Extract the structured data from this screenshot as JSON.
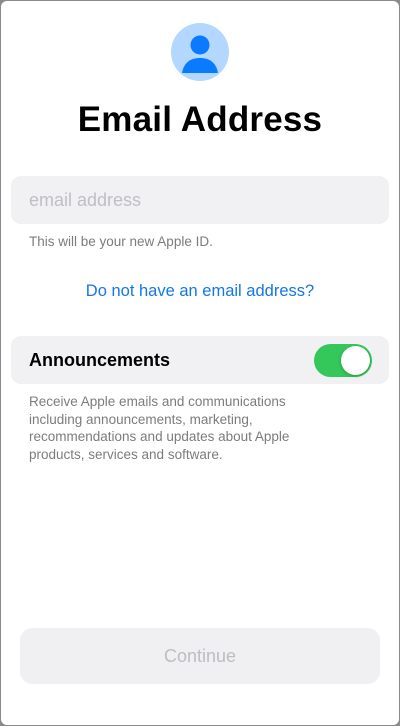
{
  "header": {
    "avatar_icon": "person-circle-icon",
    "avatar_bg": "#b4d7ff",
    "avatar_fg": "#0a7aff",
    "title": "Email Address"
  },
  "email": {
    "placeholder": "email address",
    "value": "",
    "helper": "This will be your new Apple ID."
  },
  "no_email_link": "Do not have an email address?",
  "announcements": {
    "label": "Announcements",
    "enabled": true,
    "toggle_color": "#34c759",
    "description_lines": [
      "Receive Apple emails and communications",
      "including announcements, marketing,",
      "recommendations and updates about Apple",
      "products, services and software."
    ]
  },
  "footer": {
    "continue_label": "Continue",
    "continue_enabled": false
  }
}
